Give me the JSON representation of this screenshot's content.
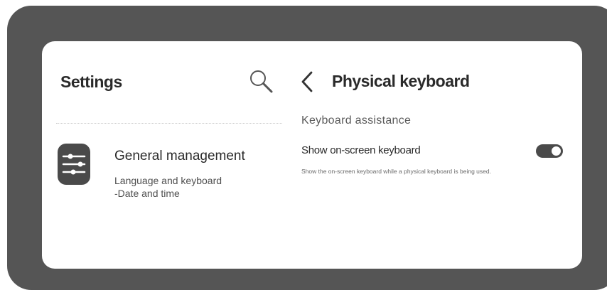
{
  "settings_pane": {
    "title": "Settings",
    "search_icon": "search-icon",
    "menu_item": {
      "icon": "sliders-icon",
      "title": "General management",
      "subtitle_line1": "Language and keyboard",
      "subtitle_line2": "-Date and time"
    }
  },
  "detail_pane": {
    "back_icon": "chevron-left-icon",
    "title": "Physical keyboard",
    "section_header": "Keyboard assistance",
    "setting": {
      "label": "Show on-screen keyboard",
      "description": "Show the on-screen keyboard while a physical keyboard is being used.",
      "toggle_on": true
    }
  },
  "colors": {
    "bezel": "#555555",
    "text_primary": "#2a2a2a",
    "accent": "#4a4a4a"
  }
}
